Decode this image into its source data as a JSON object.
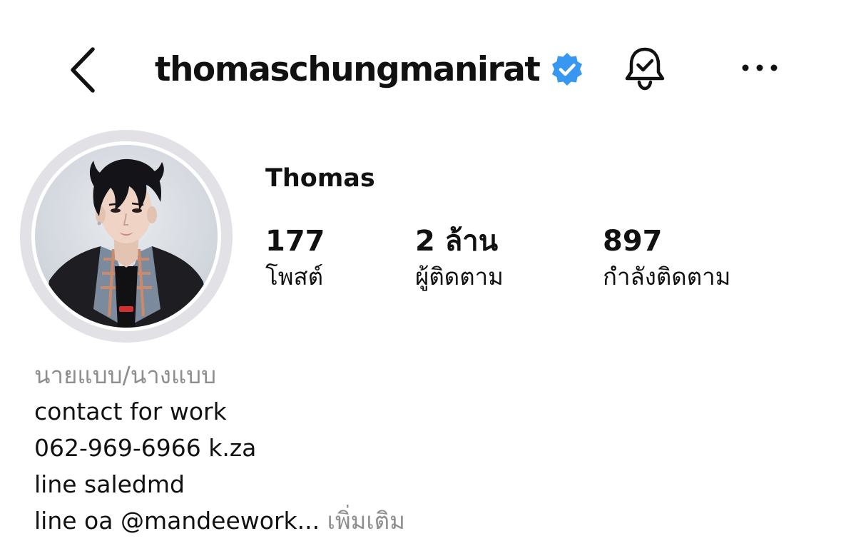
{
  "header": {
    "username": "thomaschungmanirat",
    "verified_color": "#3897f0",
    "icons": {
      "back": "chevron-left-icon",
      "verified": "verified-badge-icon",
      "notifications": "bell-check-icon",
      "more": "more-horizontal-icon"
    }
  },
  "profile": {
    "display_name": "Thomas",
    "stats": {
      "posts": {
        "value": "177",
        "label": "โพสต์"
      },
      "followers": {
        "value": "2 ล้าน",
        "label": "ผู้ติดตาม"
      },
      "following": {
        "value": "897",
        "label": "กำลังติดตาม"
      }
    }
  },
  "bio": {
    "category": "นายแบบ/นางแบบ",
    "line1": "contact for work",
    "line2": "062-969-6966 k.za",
    "line3": "line saledmd",
    "line4": "line oa @mandeework...",
    "more_label": "เพิ่มเติม"
  },
  "colors": {
    "text": "#111111",
    "secondary_text": "#8e8e8e",
    "ring": "#e2e2e6"
  }
}
